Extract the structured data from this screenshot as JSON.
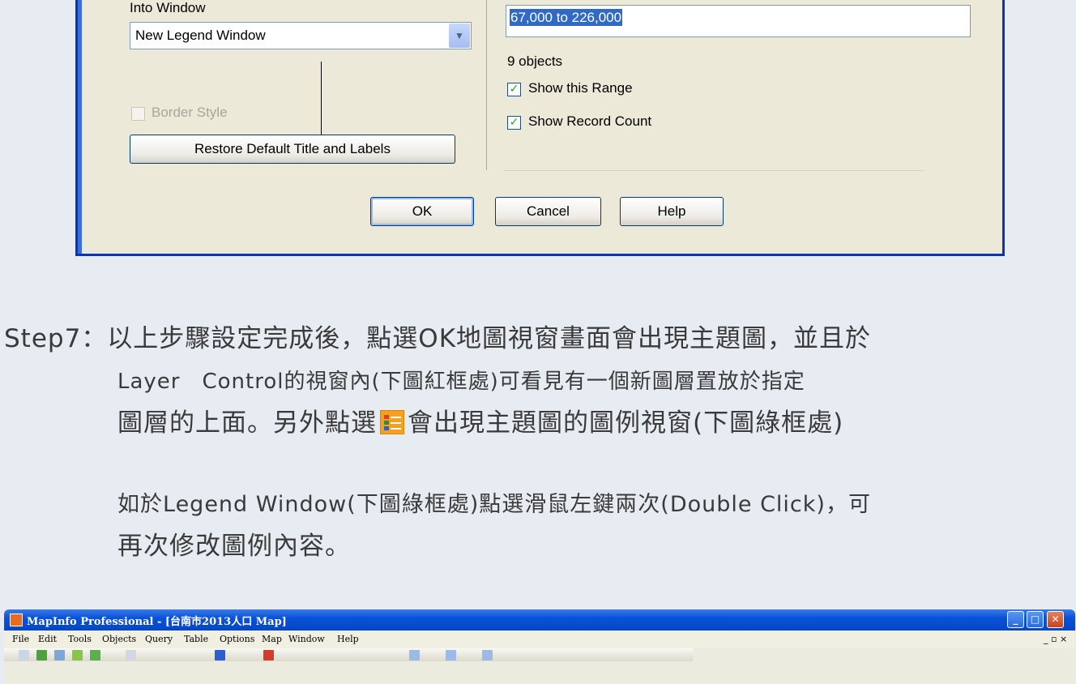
{
  "dialog": {
    "into_window_label": "Into Window",
    "into_window_value": "New Legend Window",
    "border_style_label": "Border Style",
    "restore_button": "Restore Default Title and Labels",
    "range_value": "67,000 to 226,000",
    "object_count": "9 objects",
    "show_range_label": "Show this Range",
    "show_count_label": "Show Record Count",
    "ok_button": "OK",
    "cancel_button": "Cancel",
    "help_button": "Help"
  },
  "instructions": {
    "line1": "Step7：以上步驟設定完成後，點選OK地圖視窗畫面會出現主題圖，並且於",
    "line2": "Layer　Control的視窗內(下圖紅框處)可看見有一個新圖層置放於指定",
    "line3_a": "圖層的上面。另外點選",
    "line3_b": "會出現主題圖的圖例視窗(下圖綠框處)",
    "line4": "如於Legend Window(下圖綠框處)點選滑鼠左鍵兩次(Double Click)，可",
    "line5": "再次修改圖例內容。"
  },
  "mapinfo": {
    "title": "MapInfo Professional - [台南市2013人口 Map]",
    "menus": [
      "File",
      "Edit",
      "Tools",
      "Objects",
      "Query",
      "Table",
      "Options",
      "Map",
      "Window",
      "Help"
    ],
    "mdi_controls": "_ ▫ ×"
  },
  "colors": {
    "titlebar": "#0a52d8",
    "dialog_border": "#0a35b8",
    "highlight": "#316ac5",
    "check": "#21a121"
  },
  "icons": [
    "legend-window-icon",
    "minimize-icon",
    "maximize-icon",
    "close-icon",
    "dropdown-arrow-icon",
    "check-icon"
  ]
}
